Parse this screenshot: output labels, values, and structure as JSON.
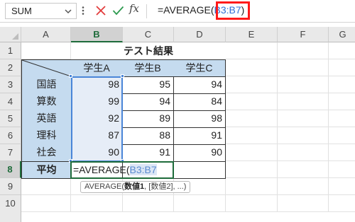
{
  "formula_bar": {
    "name_box": "SUM",
    "fx_label": "fx",
    "formula_prefix": "=AVERAGE(",
    "formula_ref": "B3:B7",
    "formula_suffix": ")"
  },
  "columns": [
    "A",
    "B",
    "C",
    "D",
    "E",
    "F",
    "G"
  ],
  "rows": [
    "1",
    "2",
    "3",
    "4",
    "5",
    "6",
    "7",
    "8",
    "9",
    "10"
  ],
  "table": {
    "title": "テスト結果",
    "students": [
      "学生A",
      "学生B",
      "学生C"
    ],
    "subjects": [
      {
        "name": "国語",
        "scores": [
          "98",
          "95",
          "94"
        ]
      },
      {
        "name": "算数",
        "scores": [
          "99",
          "94",
          "84"
        ]
      },
      {
        "name": "英語",
        "scores": [
          "92",
          "89",
          "98"
        ]
      },
      {
        "name": "理科",
        "scores": [
          "87",
          "88",
          "91"
        ]
      },
      {
        "name": "社会",
        "scores": [
          "90",
          "91",
          "90"
        ]
      }
    ],
    "average_label": "平均"
  },
  "editing": {
    "prefix": "=AVERAGE(",
    "ref": "B3:B7"
  },
  "tooltip": {
    "fn": "AVERAGE(",
    "arg1": "数値1",
    "rest": ", [数値2], ...)"
  },
  "colors": {
    "accent_green": "#1e6b3a",
    "range_blue": "#4a86d8",
    "header_blue": "#c5dbef",
    "highlight_red": "#ff1a1a"
  }
}
